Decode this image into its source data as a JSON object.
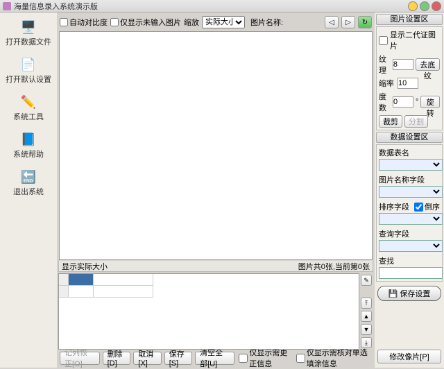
{
  "window": {
    "title": "海量信息录入系统演示版"
  },
  "sidebar": {
    "items": [
      {
        "label": "打开数据文件",
        "icon": "🖥️"
      },
      {
        "label": "打开默认设置",
        "icon": "📄"
      },
      {
        "label": "系统工具",
        "icon": "✏️"
      },
      {
        "label": "系统帮助",
        "icon": "📘"
      },
      {
        "label": "退出系统",
        "icon": "🔚"
      }
    ]
  },
  "topbar": {
    "auto_contrast": "自动对比度",
    "only_uninput": "仅显示未输入图片",
    "zoom_label": "缩放",
    "zoom_value": "实际大小",
    "img_name_label": "图片名称:"
  },
  "status": {
    "left": "显示实际大小",
    "right": "图片共0张,当前第0张"
  },
  "buttons": {
    "restore": "记列恢正[O]",
    "delete": "删除[D]",
    "cancel": "取消[X]",
    "save": "保存[S]",
    "clearall": "清空全部[U]",
    "only_correct": "仅显示需更正信息",
    "only_review": "仅显示需核对单选填涂信息"
  },
  "right": {
    "img_section": "图片设置区",
    "show_2d": "显示二代证图片",
    "wenli": "纹理",
    "wenli_v": "8",
    "suolv": "缩率",
    "suolv_v": "10",
    "dushu": "度数",
    "dushu_v": "0",
    "deg": "°",
    "qudiwen": "去底纹",
    "xuanzhuan": "旋转",
    "caijian": "裁剪",
    "fenge": "分割",
    "data_section": "数据设置区",
    "table_name": "数据表名",
    "img_field": "图片名称字段",
    "sort_field": "排序字段",
    "reverse": "倒序",
    "query_field": "查询字段",
    "find": "查找",
    "save_setting": "保存设置",
    "modify_img": "修改像片[P]"
  }
}
